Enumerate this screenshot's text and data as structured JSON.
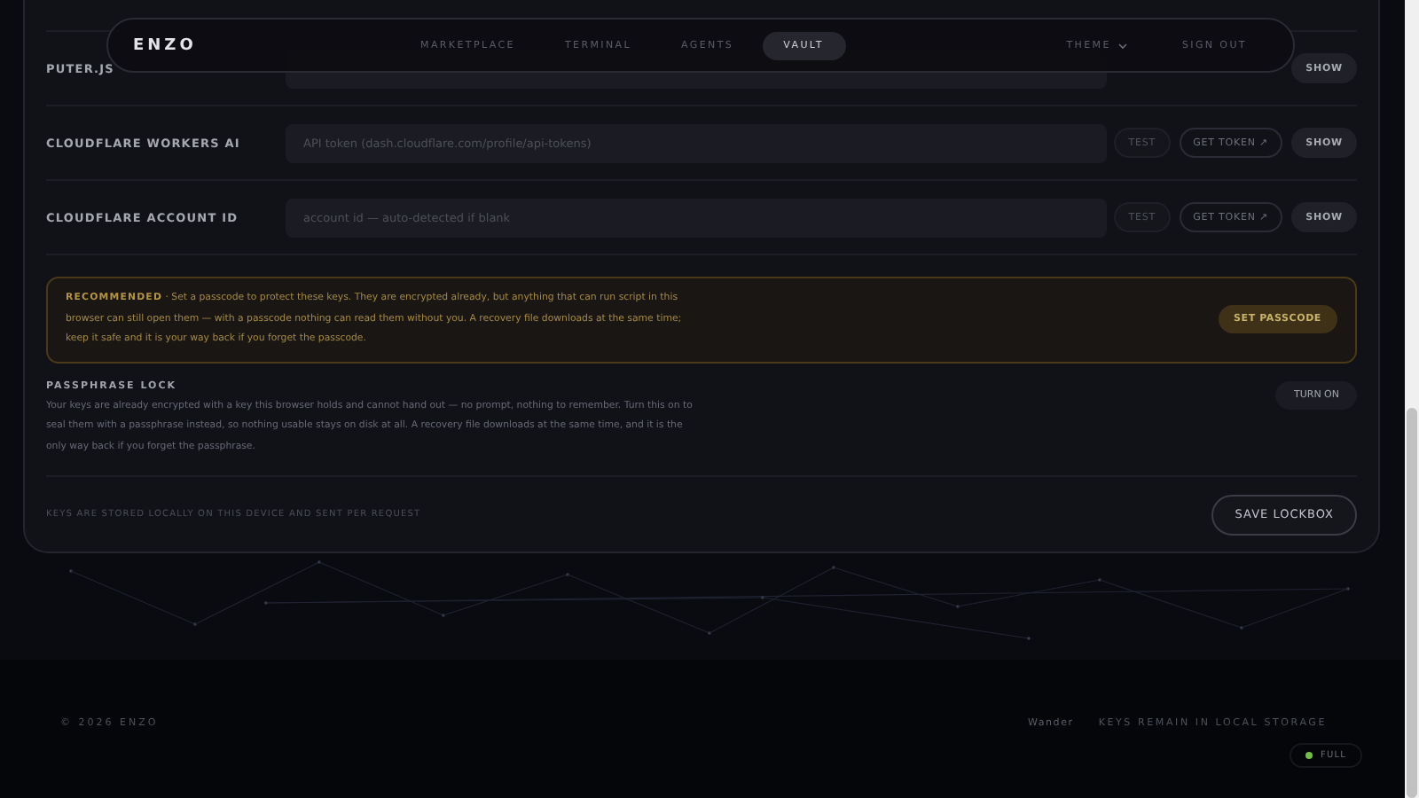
{
  "nav": {
    "logo": "ENZO",
    "links": [
      {
        "label": "MARKETPLACE",
        "selected": false
      },
      {
        "label": "TERMINAL",
        "selected": false
      },
      {
        "label": "AGENTS",
        "selected": false
      },
      {
        "label": "VAULT",
        "selected": true
      }
    ],
    "theme": "THEME",
    "sign_out": "SIGN OUT"
  },
  "keys": [
    {
      "label": "PUTER.JS",
      "buttons": [
        "SHOW"
      ]
    },
    {
      "label": "CLOUDFLARE WORKERS AI",
      "placeholder": "API token (dash.cloudflare.com/profile/api-tokens)",
      "buttons": [
        "TEST",
        "GET TOKEN ↗",
        "SHOW"
      ]
    },
    {
      "label": "CLOUDFLARE ACCOUNT ID",
      "placeholder": "account id — auto-detected if blank",
      "buttons": [
        "TEST",
        "GET TOKEN ↗",
        "SHOW"
      ]
    }
  ],
  "notice": {
    "text": "**RECOMMENDED** · Set a passcode to protect these keys. They are encrypted already, but anything that can run script in this browser can still open them — with a passcode nothing can read them without you. A recovery file downloads at the same time; keep it safe and it is your way back if you forget the passcode.",
    "button": "SET PASSCODE"
  },
  "passphrase_lock": {
    "title": "PASSPHRASE LOCK",
    "text": "Your keys are already encrypted with a key this browser holds and cannot hand out — no prompt, nothing to remember. Turn this on to seal them with a passphrase instead, so nothing usable stays on disk at all. A recovery file downloads at the same time, and it is the only way back if you forget the passphrase.",
    "button": "TURN ON"
  },
  "card_footer": {
    "note": "KEYS ARE STORED LOCALLY ON THIS DEVICE AND SENT PER REQUEST",
    "button": "SAVE LOCKBOX"
  },
  "footer": {
    "copyright": "© 2026 ENZO",
    "link": "Wander",
    "note": "KEYS REMAIN IN LOCAL STORAGE",
    "status": {
      "label": "FULL",
      "color": "#6fbf4a"
    }
  }
}
